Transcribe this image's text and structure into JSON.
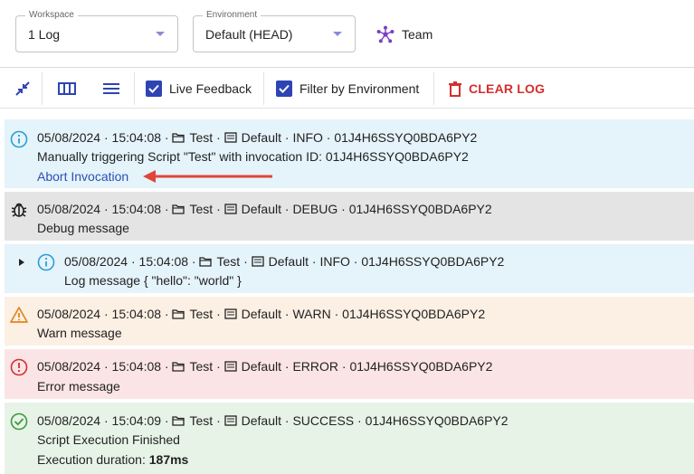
{
  "topbar": {
    "workspace": {
      "label": "Workspace",
      "value": "1 Log"
    },
    "environment": {
      "label": "Environment",
      "value": "Default (HEAD)"
    },
    "team_label": "Team"
  },
  "toolbar": {
    "live_feedback_label": "Live Feedback",
    "filter_env_label": "Filter by Environment",
    "clear_label": "CLEAR LOG"
  },
  "logs": [
    {
      "level": "INFO",
      "date": "05/08/2024",
      "time": "15:04:08",
      "script": "Test",
      "env": "Default",
      "id": "01J4H6SSYQ0BDA6PY2",
      "message": "Manually triggering Script \"Test\" with invocation ID: 01J4H6SSYQ0BDA6PY2",
      "action": "Abort Invocation"
    },
    {
      "level": "DEBUG",
      "date": "05/08/2024",
      "time": "15:04:08",
      "script": "Test",
      "env": "Default",
      "id": "01J4H6SSYQ0BDA6PY2",
      "message": "Debug message"
    },
    {
      "level": "INFO",
      "date": "05/08/2024",
      "time": "15:04:08",
      "script": "Test",
      "env": "Default",
      "id": "01J4H6SSYQ0BDA6PY2",
      "message": "Log message { \"hello\": \"world\" }"
    },
    {
      "level": "WARN",
      "date": "05/08/2024",
      "time": "15:04:08",
      "script": "Test",
      "env": "Default",
      "id": "01J4H6SSYQ0BDA6PY2",
      "message": "Warn message"
    },
    {
      "level": "ERROR",
      "date": "05/08/2024",
      "time": "15:04:08",
      "script": "Test",
      "env": "Default",
      "id": "01J4H6SSYQ0BDA6PY2",
      "message": "Error message"
    },
    {
      "level": "SUCCESS",
      "date": "05/08/2024",
      "time": "15:04:09",
      "script": "Test",
      "env": "Default",
      "id": "01J4H6SSYQ0BDA6PY2",
      "message": "Script Execution Finished",
      "duration_label": "Execution duration:",
      "duration_value": "187ms"
    }
  ],
  "sep": "·",
  "colors": {
    "info": "#2a9fd6",
    "debug": "#222222",
    "warn": "#e0861c",
    "error": "#d32f2f",
    "success": "#3d9a3d",
    "accent": "#2e44b4",
    "arrow": "#e0453a"
  },
  "icons": [
    "collapse-icon",
    "columns-icon",
    "menu-icon",
    "team-icon",
    "trash-icon",
    "folder-icon",
    "terminal-icon",
    "info-icon",
    "bug-icon",
    "warning-icon",
    "error-icon",
    "check-circle-icon",
    "expand-caret-icon"
  ]
}
